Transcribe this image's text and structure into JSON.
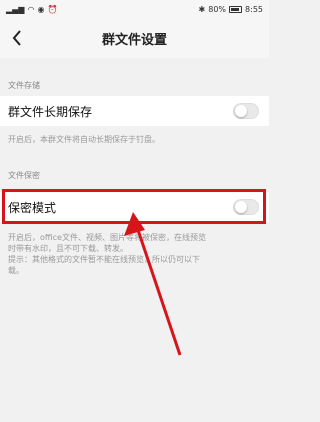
{
  "status_bar": {
    "left_icons": "signal-wifi-eye-alarm",
    "bluetooth": "✱",
    "battery_percent": "80%",
    "time": "8:55"
  },
  "nav": {
    "title": "群文件设置",
    "back_icon": "chevron-left-icon"
  },
  "sections": {
    "storage": {
      "label": "文件存储",
      "row_label": "群文件长期保存",
      "toggle_on": false,
      "description": "开启后，本群文件将自动长期保存于钉盘。"
    },
    "privacy": {
      "label": "文件保密",
      "row_label": "保密模式",
      "toggle_on": false,
      "description_line1": "开启后，office文件、视频、图片等将被保密，在线预览",
      "description_line2": "时带有水印，且不可下载、转发。",
      "description_line3": "提示：其他格式的文件暂不能在线预览，所以仍可以下",
      "description_line4": "载。"
    }
  },
  "annotation": {
    "highlight_color": "#d7141a",
    "arrow_color": "#d7141a"
  }
}
